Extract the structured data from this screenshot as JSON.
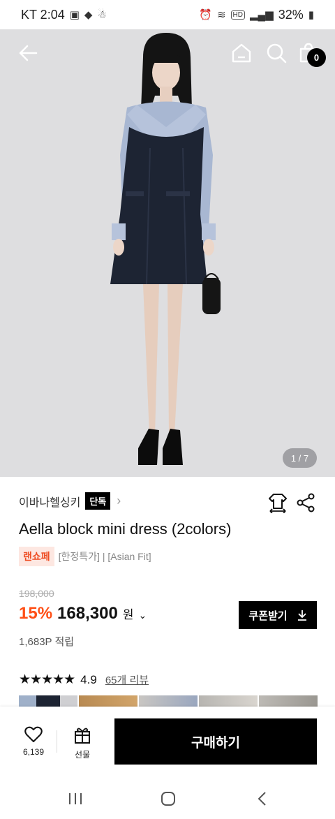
{
  "status_bar": {
    "carrier_time": "KT 2:04",
    "battery": "32%",
    "hd_label": "HD"
  },
  "hero": {
    "page_indicator": "1 / 7",
    "cart_count": "0"
  },
  "product": {
    "brand": "이바나헬싱키",
    "exclusive_label": "단독",
    "title": "Aella block mini dress (2colors)",
    "tag_badge": "랜쇼페",
    "tags_text": "[한정특가] | [Asian Fit]",
    "original_price": "198,000",
    "discount": "15%",
    "price": "168,300",
    "currency": "원",
    "coupon_label": "쿠폰받기",
    "points": "1,683P 적립",
    "rating": "4.9",
    "review_link": "65개 리뷰",
    "stars": "★★★★★"
  },
  "bottom": {
    "like_count": "6,139",
    "gift_label": "선물",
    "buy_label": "구매하기"
  },
  "icons": [
    "back-arrow-icon",
    "home-icon",
    "search-icon",
    "cart-icon",
    "hanger-icon",
    "share-icon",
    "heart-icon",
    "gift-icon",
    "download-icon",
    "chevron-right-icon",
    "chevron-down-icon",
    "recent-apps-icon",
    "home-nav-icon",
    "back-nav-icon"
  ],
  "colors": {
    "accent": "#ff4f16",
    "tag_bg": "#fde7e1",
    "tag_text": "#ee4e24",
    "button": "#000000"
  }
}
